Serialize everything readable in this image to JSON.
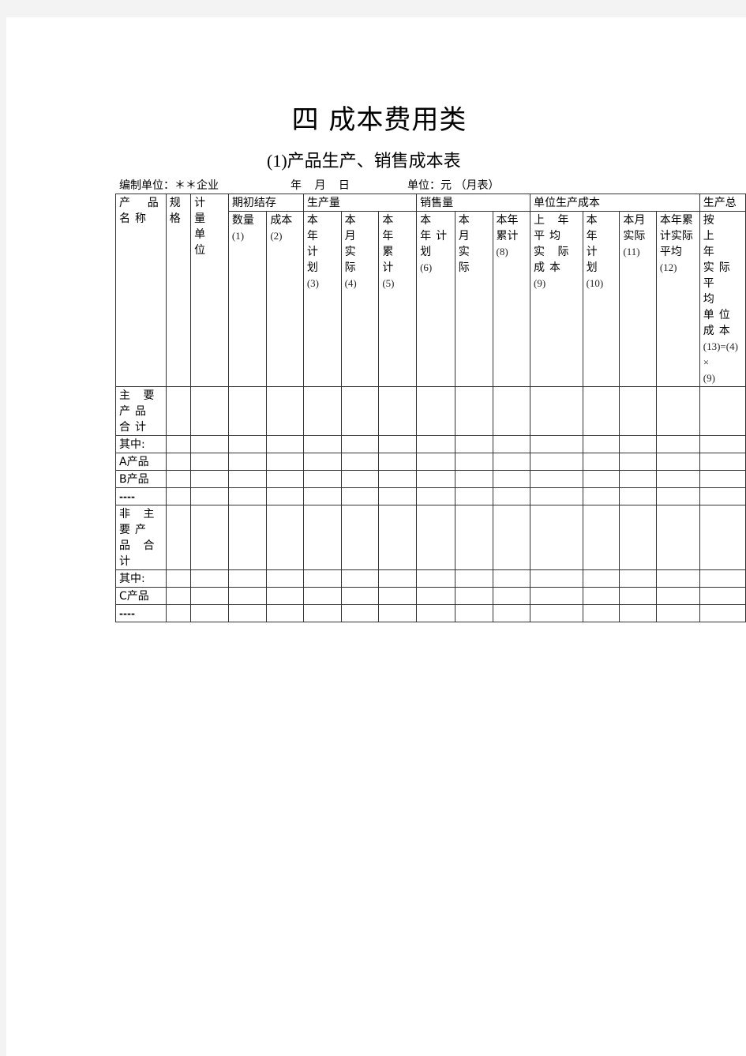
{
  "document": {
    "title": "四 成本费用类",
    "subtitle_num": "(1)",
    "subtitle_text": "产品生产、销售成本表",
    "meta": {
      "unit_label": "编制单位：",
      "unit_value": "＊＊企业",
      "date": "年 月 日",
      "currency": "单位：元 （月表）"
    }
  },
  "table": {
    "groups": {
      "product_name": "产 品 名称",
      "spec": "规格",
      "measure_unit": "计 量单位",
      "opening_stock": "期初结存",
      "production": "生产量",
      "sales": "销售量",
      "unit_cost": "单位生产成本",
      "production_total": "生产总"
    },
    "sub_headers": [
      {
        "label": "数量",
        "code": "(1)"
      },
      {
        "label": "成本",
        "code": "(2)"
      },
      {
        "label": "本 年计划",
        "code": "(3)"
      },
      {
        "label": "本 月实际",
        "code": "(4)"
      },
      {
        "label": "本 年累计",
        "code": "(5)"
      },
      {
        "label": "本 年计划",
        "code": "(6)"
      },
      {
        "label": "本 月实际",
        "code": ""
      },
      {
        "label": "本年累计",
        "code": "(8)"
      },
      {
        "label": "上 年 平均 实 际成本",
        "code": "(9)"
      },
      {
        "label": "本 年计划",
        "code": "(10)"
      },
      {
        "label": "本月实际",
        "code": "(11)"
      },
      {
        "label": "本年累计实际平均",
        "code": "(12)"
      },
      {
        "label": "按 上 年 实际 平 均 单位成本",
        "code": "(13)=(4)×",
        "code2": "(9)"
      }
    ],
    "rows": [
      {
        "label": "主 要 产品合计",
        "type": "r2"
      },
      {
        "label": "其中:",
        "type": "r1"
      },
      {
        "label": "A产品",
        "type": "r1"
      },
      {
        "label": "B产品",
        "type": "r1"
      },
      {
        "label": "----",
        "type": "r1"
      },
      {
        "label": "非 主 要产 品 合计",
        "type": "r3"
      },
      {
        "label": "其中:",
        "type": "r1"
      },
      {
        "label": "C产品",
        "type": "r1"
      },
      {
        "label": "----",
        "type": "r1"
      }
    ]
  }
}
